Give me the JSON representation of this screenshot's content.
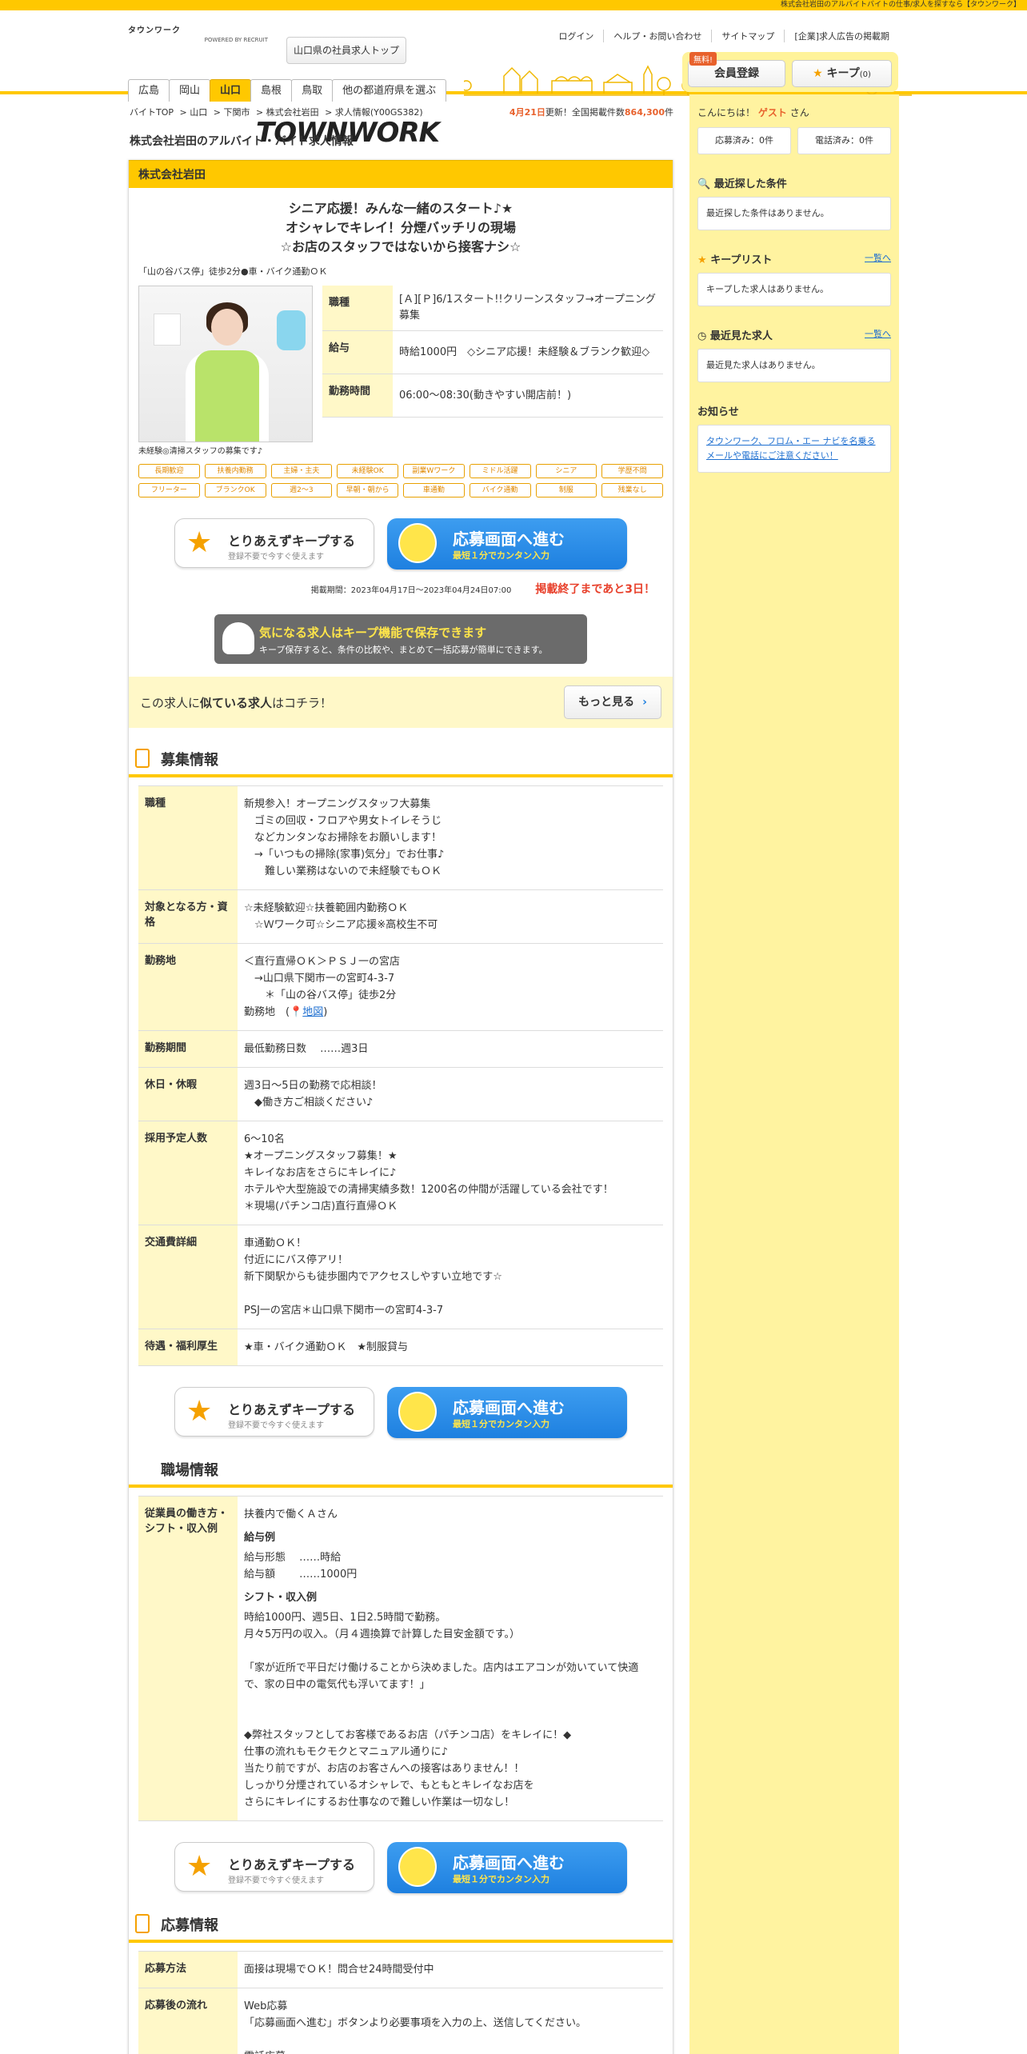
{
  "topbar": "株式会社岩田のアルバイトバイトの仕事/求人を探すなら【タウンワーク】",
  "header": {
    "logo_kana": "タウンワーク",
    "logo_text": "TOWNWORK",
    "logo_sub": "POWERED BY RECRUIT",
    "top_button": "山口県の社員求人トップ",
    "links": [
      "ログイン",
      "ヘルプ・お問い合わせ",
      "サイトマップ",
      "[企業]求人広告の掲載期"
    ],
    "pref_tabs": [
      "広島",
      "岡山",
      "山口",
      "島根",
      "鳥取",
      "他の都道府県を選ぶ"
    ],
    "free_tag": "無料!",
    "member_button": "会員登録",
    "keep_button": "キープ",
    "keep_count": "(0)"
  },
  "breadcrumb": [
    "バイトTOP",
    "山口",
    "下関市",
    "株式会社岩田",
    "求人情報(Y00GS382)"
  ],
  "update": {
    "date": "4月21日",
    "text1": "更新！全国掲載件数",
    "count": "864,300",
    "text2": "件"
  },
  "page_title": "株式会社岩田のアルバイト・バイト求人情報",
  "job": {
    "company": "株式会社岩田",
    "catch": [
      "シニア応援！みんな一緒のスタート♪★",
      "オシャレでキレイ！分煙バッチリの現場",
      "☆お店のスタッフではないから接客ナシ☆"
    ],
    "access": "「山の谷バス停」徒歩2分●車・バイク通勤ＯＫ",
    "photo_caption": "未経験◎清掃スタッフの募集です♪",
    "summary": [
      {
        "k": "職種",
        "v": "[Ａ][Ｐ]6/1スタート!!クリーンスタッフ→オープニング募集"
      },
      {
        "k": "給与",
        "v": "時給1000円　◇シニア応援！未経験＆ブランク歓迎◇"
      },
      {
        "k": "勤務時間",
        "v": "06:00～08:30(動きやすい開店前！)"
      }
    ],
    "tags": [
      "長期歓迎",
      "扶養内勤務",
      "主婦・主夫",
      "未経験OK",
      "副業Wワーク",
      "ミドル活躍",
      "シニア",
      "学歴不問",
      "フリーター",
      "ブランクOK",
      "週2～3",
      "早朝・朝から",
      "車通勤",
      "バイク通勤",
      "制服",
      "残業なし"
    ],
    "keep_btn": {
      "t1": "とりあえずキープする",
      "t2": "登録不要で今すぐ使えます"
    },
    "apply_btn": {
      "t1": "応募画面へ進む",
      "t2": "最短１分でカンタン入力"
    },
    "period": "掲載期間：2023年04月17日～2023年04月24日07:00",
    "remain_prefix": "掲載終了まであと",
    "remain_days": "3日",
    "remain_suffix": "！",
    "keep_banner": {
      "t1": "気になる求人はキープ機能で保存できます",
      "t2": "キープ保存すると、条件の比較や、まとめて一括応募が簡単にできます。"
    },
    "similar": {
      "pre": "この求人に",
      "bold": "似ている求人",
      "post": "はコチラ！",
      "button": "もっと見る"
    }
  },
  "recruit": {
    "title": "募集情報",
    "rows": [
      {
        "k": "職種",
        "v": "新規参入！オープニングスタッフ大募集\n　ゴミの回収・フロアや男女トイレそうじ\n　などカンタンなお掃除をお願いします！\n　→「いつもの掃除(家事)気分」でお仕事♪\n　　難しい業務はないので未経験でもＯＫ"
      },
      {
        "k": "対象となる方・資格",
        "v": "☆未経験歓迎☆扶養範囲内勤務ＯＫ\n　☆Ｗワーク可☆シニア応援※高校生不可"
      },
      {
        "k": "勤務地",
        "v": "＜直行直帰ＯＫ＞ＰＳＪ一の宮店\n　→山口県下関市一の宮町4-3-7\n　　＊「山の谷バス停」徒歩2分\n勤務地　("
      },
      {
        "k": "勤務期間",
        "v": "最低勤務日数　 ……週3日"
      },
      {
        "k": "休日・休暇",
        "v": "週3日～5日の勤務で応相談！\n　◆働き方ご相談ください♪"
      },
      {
        "k": "採用予定人数",
        "v": "6～10名\n★オープニングスタッフ募集！★\nキレイなお店をさらにキレイに♪\nホテルや大型施設での清掃実績多数！1200名の仲間が活躍している会社です！\n＊現場(パチンコ店)直行直帰ＯＫ"
      },
      {
        "k": "交通費詳細",
        "v": "車通勤ＯＫ！\n付近ににバス停アリ！\n新下関駅からも徒歩圏内でアクセスしやすい立地です☆\n\nPSJ一の宮店＊山口県下関市一の宮町4-3-7"
      },
      {
        "k": "待遇・福利厚生",
        "v": "★車・バイク通勤ＯＫ　★制服貸与"
      }
    ],
    "map_link": "地図"
  },
  "workplace": {
    "title": "職場情報",
    "key": "従業員の働き方・シフト・収入例",
    "intro": "扶養内で働くＡさん",
    "h_salary": "給与例",
    "salary_lines": "給与形態　 ……時給\n給与額　　 ……1000円",
    "h_shift": "シフト・収入例",
    "shift_text": "時給1000円、週5日、1日2.5時間で勤務。\n月々5万円の収入。（月４週換算で計算した目安金額です。）\n\n「家が近所で平日だけ働けることから決めました。店内はエアコンが効いていて快適で、家の日中の電気代も浮いてます！」\n\n\n◆弊社スタッフとしてお客様であるお店（パチンコ店）をキレイに！◆\n仕事の流れもモクモクとマニュアル通りに♪\n当たり前ですが、お店のお客さんへの接客はありません！！\nしっかり分煙されているオシャレで、もともとキレイなお店を\nさらにキレイにするお仕事なので難しい作業は一切なし！"
  },
  "apply": {
    "title": "応募情報",
    "rows": [
      {
        "k": "応募方法",
        "v": "面接は現場でＯＫ！問合せ24時間受付中"
      },
      {
        "k": "応募後の流れ",
        "v": "Web応募\n「応募画面へ進む」ボタンより必要事項を入力の上、送信してください。\n\n電話応募\nお電話でのご応募も受け付けております。"
      }
    ]
  },
  "side": {
    "greet_pre": "こんにちは！",
    "guest": "ゲスト",
    "greet_post": "さん",
    "applied": "応募済み：0件",
    "called": "電話済み：0件",
    "recent_search": {
      "title": "最近探した条件",
      "empty": "最近探した条件はありません。"
    },
    "keep_list": {
      "title": "キープリスト",
      "link": "一覧へ",
      "empty": "キープした求人はありません。"
    },
    "recent_view": {
      "title": "最近見た求人",
      "link": "一覧へ",
      "empty": "最近見た求人はありません。"
    },
    "notice": {
      "title": "お知らせ",
      "text": "タウンワーク、フロム・エー ナビを名乗るメールや電話にご注意ください！"
    }
  }
}
